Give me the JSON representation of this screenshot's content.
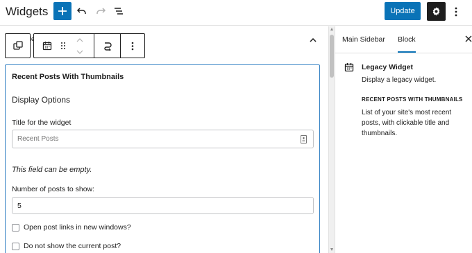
{
  "header": {
    "title": "Widgets",
    "update_label": "Update",
    "icons": [
      "plus-icon",
      "undo-icon",
      "redo-icon",
      "list-view-icon",
      "gear-icon",
      "more-vertical-icon"
    ]
  },
  "toolbar": {
    "peek_text": "le",
    "icons": [
      "copy-icon",
      "calendar-icon",
      "drag-handle-icon",
      "move-up-icon",
      "move-down-icon",
      "transform-icon",
      "more-options-icon"
    ]
  },
  "widget": {
    "title": "Recent Posts With Thumbnails",
    "section_heading": "Display Options",
    "title_field_label": "Title for the widget",
    "title_field_value": "Recent Posts",
    "field_note": "This field can be empty.",
    "posts_field_label": "Number of posts to show:",
    "posts_field_value": "5",
    "checkboxes": [
      {
        "label": "Open post links in new windows?",
        "checked": false
      },
      {
        "label": "Do not show the current post?",
        "checked": false
      }
    ]
  },
  "sidebar": {
    "tabs": [
      {
        "label": "Main Sidebar",
        "active": false
      },
      {
        "label": "Block",
        "active": true
      }
    ],
    "close_icon": "close-icon",
    "block_name": "Legacy Widget",
    "block_description": "Display a legacy widget.",
    "widget_caption": "RECENT POSTS WITH THUMBNAILS",
    "widget_description": "List of your site's most recent posts, with clickable title and thumbnails."
  },
  "colors": {
    "accent": "#0a73b7",
    "focus_border": "#3582c4",
    "dark": "#1e1e1e"
  }
}
